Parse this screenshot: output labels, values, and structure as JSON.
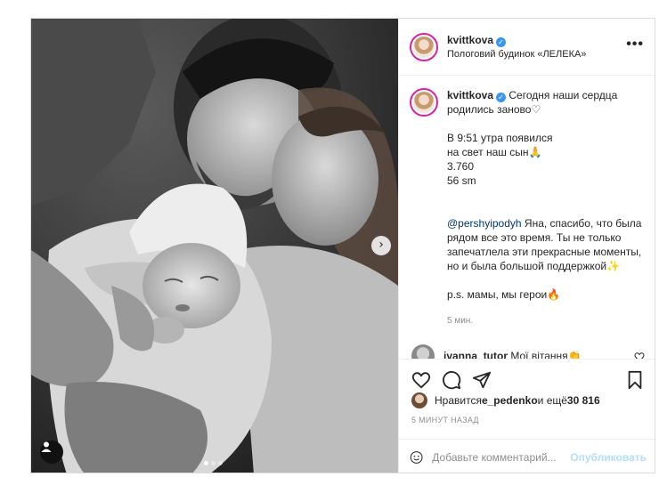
{
  "post": {
    "username": "kvittkova",
    "verified_mark": "✓",
    "location": "Пологовий будинок «ЛЕЛЕКА»",
    "more_label": "•••",
    "photo": {
      "description_icon": "newborn-family-photo",
      "next_glyph": "›",
      "dots": 3,
      "active_dot": 0
    },
    "caption": {
      "line1": "Сегодня наши сердца родились заново♡",
      "para2": "В 9:51 утра появился\nна свет наш сын🙏\n3.760\n56 sm",
      "mention": "@pershyipodyh",
      "para3_rest": " Яна, спасибо, что была рядом все это время. Ты не только запечатлела эти прекрасные моменты, но и была большой поддержкой✨",
      "para4": "p.s. мамы, мы герои🔥",
      "time": "5 мин."
    },
    "comments": [
      {
        "username": "ivanna_tutor",
        "text": "Мої вітання👏"
      }
    ],
    "likes": {
      "prefix": "Нравится ",
      "user": "e_pedenko",
      "middle": " и ещё ",
      "count": "30 816"
    },
    "ago": "5 МИНУТ НАЗАД",
    "add_comment": {
      "placeholder": "Добавьте комментарий...",
      "post_label": "Опубликовать"
    }
  },
  "colors": {
    "link": "#00376b",
    "verified": "#3897f0",
    "post_button_disabled": "#b2dffc",
    "muted": "#8e8e8e"
  }
}
